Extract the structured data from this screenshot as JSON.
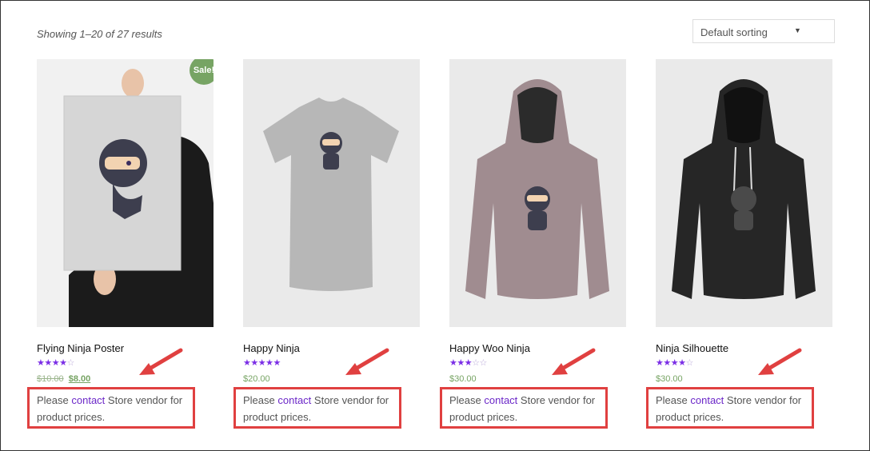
{
  "result_count": "Showing 1–20 of 27 results",
  "sorting": {
    "selected": "Default sorting"
  },
  "products": [
    {
      "title": "Flying Ninja Poster",
      "rating": 4,
      "old_price": "$10.00",
      "price": "$8.00",
      "sale_badge": "Sale!"
    },
    {
      "title": "Happy Ninja",
      "rating": 5,
      "price": "$20.00"
    },
    {
      "title": "Happy Woo Ninja",
      "rating": 3,
      "price": "$30.00"
    },
    {
      "title": "Ninja Silhouette",
      "rating": 4,
      "price": "$30.00"
    }
  ],
  "notice": {
    "before": "Please ",
    "link": "contact",
    "after": " Store vendor for product prices."
  },
  "colors": {
    "accent": "#6b27c8",
    "sale": "#77a464",
    "highlight": "#e04040"
  }
}
